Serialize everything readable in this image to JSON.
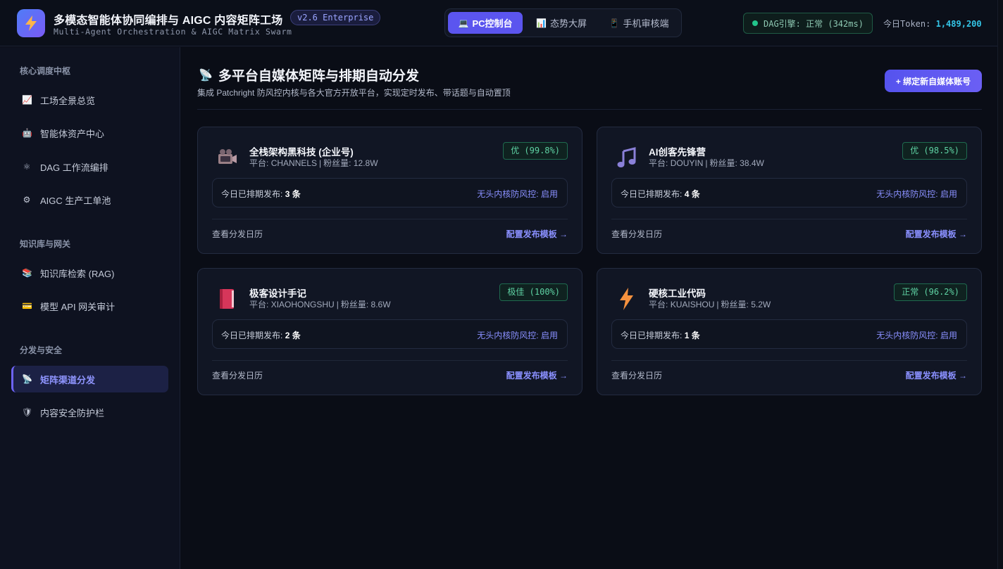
{
  "header": {
    "title": "多模态智能体协同编排与 AIGC 内容矩阵工场",
    "subtitle": "Multi-Agent Orchestration & AIGC Matrix Swarm",
    "version": "v2.6 Enterprise",
    "modes": [
      {
        "label": "PC控制台",
        "icon": "laptop-icon",
        "active": true
      },
      {
        "label": "态势大屏",
        "icon": "chart-icon",
        "active": false
      },
      {
        "label": "手机审核端",
        "icon": "phone-icon",
        "active": false
      }
    ],
    "engine_status": "DAG引擎: 正常 (342ms)",
    "token_label": "今日Token:",
    "token_value": "1,489,200"
  },
  "sidebar": {
    "groups": [
      {
        "title": "核心调度中枢",
        "items": [
          {
            "label": "工场全景总览",
            "icon": "trend-chart-icon"
          },
          {
            "label": "智能体资产中心",
            "icon": "robot-icon"
          },
          {
            "label": "DAG 工作流编排",
            "icon": "atom-icon"
          },
          {
            "label": "AIGC 生产工单池",
            "icon": "gear-icon"
          }
        ]
      },
      {
        "title": "知识库与网关",
        "items": [
          {
            "label": "知识库检索 (RAG)",
            "icon": "books-icon"
          },
          {
            "label": "模型 API 网关审计",
            "icon": "card-icon"
          }
        ]
      },
      {
        "title": "分发与安全",
        "items": [
          {
            "label": "矩阵渠道分发",
            "icon": "satellite-dish-icon",
            "active": true
          },
          {
            "label": "内容安全防护栏",
            "icon": "shield-icon"
          }
        ]
      }
    ]
  },
  "main": {
    "title": "多平台自媒体矩阵与排期自动分发",
    "title_icon": "satellite-dish-icon",
    "subtitle": "集成 Patchright 防风控内核与各大官方开放平台，实现定时发布、带话题与自动置顶",
    "bind_button": "+ 绑定新自媒体账号",
    "cards": [
      {
        "name": "全栈架构黑科技 (企业号)",
        "icon": "video-camera-icon",
        "platform_label": "平台:",
        "platform": "CHANNELS",
        "fans_label": "粉丝量:",
        "fans": "12.8W",
        "health": "优 (99.8%)",
        "sched_label": "今日已排期发布:",
        "sched_count": "3 条",
        "risk_label": "无头内核防风控:",
        "risk_value": "启用",
        "calendar_link": "查看分发日历",
        "template_link": "配置发布模板 →"
      },
      {
        "name": "AI创客先锋营",
        "icon": "music-note-icon",
        "platform_label": "平台:",
        "platform": "DOUYIN",
        "fans_label": "粉丝量:",
        "fans": "38.4W",
        "health": "优 (98.5%)",
        "sched_label": "今日已排期发布:",
        "sched_count": "4 条",
        "risk_label": "无头内核防风控:",
        "risk_value": "启用",
        "calendar_link": "查看分发日历",
        "template_link": "配置发布模板 →"
      },
      {
        "name": "极客设计手记",
        "icon": "red-book-icon",
        "platform_label": "平台:",
        "platform": "XIAOHONGSHU",
        "fans_label": "粉丝量:",
        "fans": "8.6W",
        "health": "极佳 (100%)",
        "sched_label": "今日已排期发布:",
        "sched_count": "2 条",
        "risk_label": "无头内核防风控:",
        "risk_value": "启用",
        "calendar_link": "查看分发日历",
        "template_link": "配置发布模板 →"
      },
      {
        "name": "硬核工业代码",
        "icon": "lightning-icon",
        "platform_label": "平台:",
        "platform": "KUAISHOU",
        "fans_label": "粉丝量:",
        "fans": "5.2W",
        "health": "正常 (96.2%)",
        "sched_label": "今日已排期发布:",
        "sched_count": "1 条",
        "risk_label": "无头内核防风控:",
        "risk_value": "启用",
        "calendar_link": "查看分发日历",
        "template_link": "配置发布模板 →"
      }
    ]
  },
  "colors": {
    "accent": "#5b55ef",
    "link": "#8a90ff",
    "success": "#5fd3a4",
    "token": "#34c6e8",
    "background": "#0a0d16"
  }
}
